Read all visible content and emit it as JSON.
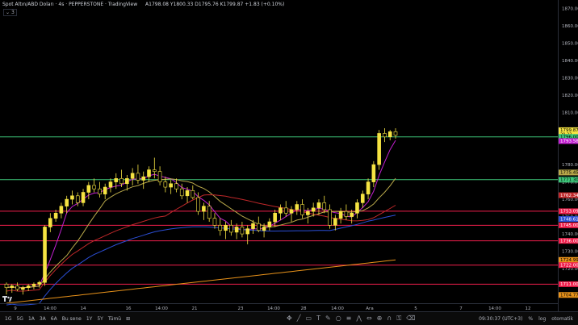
{
  "legend": {
    "symbol": "Spot Altın/ABD Doları · 4s · PEPPERSTONE · TradingView",
    "ohlc": "A1798.08 Y1800.33 D1795.76 K1799.87 +1.83 (+0.10%)",
    "collapse_label": "3"
  },
  "colors": {
    "background": "#000000",
    "up_candle": "#f5e342",
    "ma_purple": "#c31fd1",
    "ma_khaki": "#b8a84a",
    "ma_red": "#c0282a",
    "ma_blue": "#2b4ed6",
    "ma_orange": "#e8921a",
    "hline_red": "#f01e4b",
    "hline_green": "#3ec77a"
  },
  "price_axis": {
    "ticks": [
      "1870.00",
      "1860.00",
      "1850.00",
      "1840.00",
      "1830.00",
      "1820.00",
      "1810.00",
      "1780.00",
      "1770.00",
      "1760.00",
      "1750.00",
      "1740.00",
      "1730.00",
      "1720.00"
    ],
    "badges": [
      {
        "label": "1799.87",
        "sub": "29:22",
        "bg": "#f5e342",
        "fg": "#000"
      },
      {
        "label": "1796.00",
        "bg": "#3ec77a",
        "fg": "#000"
      },
      {
        "label": "1793.58",
        "bg": "#c31fd1",
        "fg": "#fff"
      },
      {
        "label": "1775.45",
        "bg": "#b8a84a",
        "fg": "#000"
      },
      {
        "label": "1771.30",
        "bg": "#3ec77a",
        "fg": "#000"
      },
      {
        "label": "1762.34",
        "bg": "#c0282a",
        "fg": "#fff"
      },
      {
        "label": "1753.09",
        "bg": "#f01e4b",
        "fg": "#fff"
      },
      {
        "label": "1748.61",
        "bg": "#2b4ed6",
        "fg": "#fff"
      },
      {
        "label": "1745.00",
        "bg": "#f01e4b",
        "fg": "#fff"
      },
      {
        "label": "1736.00",
        "bg": "#f01e4b",
        "fg": "#fff"
      },
      {
        "label": "1724.99",
        "bg": "#e8921a",
        "fg": "#000"
      },
      {
        "label": "1722.00",
        "bg": "#f01e4b",
        "fg": "#fff"
      },
      {
        "label": "1711.00",
        "bg": "#f01e4b",
        "fg": "#fff"
      },
      {
        "label": "1704.77",
        "bg": "#e8921a",
        "fg": "#000"
      }
    ]
  },
  "time_axis": [
    "9",
    "14:00",
    "14",
    "16",
    "14:00",
    "21",
    "23",
    "14:00",
    "28",
    "14:00",
    "Ara",
    "5",
    "7",
    "14:00",
    "12"
  ],
  "bottombar": {
    "ranges": [
      "1G",
      "5G",
      "1A",
      "3A",
      "6A",
      "Bu sene",
      "1Y",
      "5Y",
      "Tümü"
    ],
    "clock": "09:30:37 (UTC+3)",
    "percent": "%",
    "log": "log",
    "auto": "otomatik"
  },
  "chart_data": {
    "type": "candlestick",
    "ylim": [
      1700,
      1875
    ],
    "horizontal_levels": [
      {
        "value": 1796.0,
        "color": "green"
      },
      {
        "value": 1771.3,
        "color": "green"
      },
      {
        "value": 1753.09,
        "color": "red"
      },
      {
        "value": 1745.0,
        "color": "red"
      },
      {
        "value": 1736.0,
        "color": "red"
      },
      {
        "value": 1722.0,
        "color": "red"
      },
      {
        "value": 1711.0,
        "color": "red"
      }
    ],
    "candles": [
      [
        1711,
        1712,
        1705,
        1709
      ],
      [
        1709,
        1711,
        1706,
        1710
      ],
      [
        1710,
        1712,
        1707,
        1708
      ],
      [
        1708,
        1710,
        1705,
        1709
      ],
      [
        1709,
        1711,
        1707,
        1710
      ],
      [
        1710,
        1712,
        1708,
        1711
      ],
      [
        1711,
        1713,
        1709,
        1712
      ],
      [
        1712,
        1745,
        1710,
        1744
      ],
      [
        1744,
        1752,
        1741,
        1749
      ],
      [
        1749,
        1754,
        1747,
        1752
      ],
      [
        1752,
        1758,
        1749,
        1756
      ],
      [
        1756,
        1762,
        1752,
        1760
      ],
      [
        1760,
        1765,
        1757,
        1762
      ],
      [
        1762,
        1764,
        1756,
        1758
      ],
      [
        1758,
        1766,
        1756,
        1764
      ],
      [
        1764,
        1770,
        1760,
        1768
      ],
      [
        1768,
        1772,
        1764,
        1766
      ],
      [
        1766,
        1770,
        1761,
        1763
      ],
      [
        1763,
        1769,
        1760,
        1767
      ],
      [
        1767,
        1772,
        1764,
        1770
      ],
      [
        1770,
        1775,
        1766,
        1772
      ],
      [
        1772,
        1777,
        1767,
        1769
      ],
      [
        1769,
        1774,
        1765,
        1772
      ],
      [
        1772,
        1778,
        1768,
        1775
      ],
      [
        1775,
        1780,
        1769,
        1771
      ],
      [
        1771,
        1776,
        1766,
        1773
      ],
      [
        1773,
        1779,
        1770,
        1777
      ],
      [
        1777,
        1784,
        1772,
        1776
      ],
      [
        1776,
        1779,
        1768,
        1770
      ],
      [
        1770,
        1773,
        1764,
        1767
      ],
      [
        1767,
        1771,
        1763,
        1769
      ],
      [
        1769,
        1772,
        1764,
        1766
      ],
      [
        1766,
        1769,
        1760,
        1762
      ],
      [
        1762,
        1767,
        1758,
        1765
      ],
      [
        1765,
        1768,
        1760,
        1761
      ],
      [
        1761,
        1764,
        1751,
        1753
      ],
      [
        1753,
        1758,
        1748,
        1756
      ],
      [
        1756,
        1759,
        1747,
        1749
      ],
      [
        1749,
        1752,
        1743,
        1745
      ],
      [
        1745,
        1749,
        1739,
        1742
      ],
      [
        1742,
        1747,
        1737,
        1745
      ],
      [
        1745,
        1748,
        1739,
        1741
      ],
      [
        1741,
        1746,
        1737,
        1744
      ],
      [
        1744,
        1747,
        1738,
        1740
      ],
      [
        1740,
        1745,
        1734,
        1743
      ],
      [
        1743,
        1748,
        1740,
        1746
      ],
      [
        1746,
        1750,
        1741,
        1742
      ],
      [
        1742,
        1746,
        1738,
        1744
      ],
      [
        1744,
        1749,
        1742,
        1747
      ],
      [
        1747,
        1754,
        1744,
        1752
      ],
      [
        1752,
        1757,
        1748,
        1755
      ],
      [
        1755,
        1759,
        1750,
        1752
      ],
      [
        1752,
        1756,
        1747,
        1754
      ],
      [
        1754,
        1759,
        1751,
        1757
      ],
      [
        1757,
        1760,
        1749,
        1751
      ],
      [
        1751,
        1755,
        1746,
        1753
      ],
      [
        1753,
        1758,
        1750,
        1755
      ],
      [
        1755,
        1760,
        1751,
        1758
      ],
      [
        1758,
        1762,
        1752,
        1754
      ],
      [
        1754,
        1757,
        1743,
        1745
      ],
      [
        1745,
        1751,
        1742,
        1749
      ],
      [
        1749,
        1755,
        1746,
        1753
      ],
      [
        1753,
        1757,
        1748,
        1750
      ],
      [
        1750,
        1754,
        1746,
        1752
      ],
      [
        1752,
        1760,
        1749,
        1758
      ],
      [
        1758,
        1765,
        1755,
        1763
      ],
      [
        1763,
        1772,
        1760,
        1770
      ],
      [
        1770,
        1782,
        1767,
        1780
      ],
      [
        1780,
        1800,
        1777,
        1798
      ],
      [
        1798,
        1801,
        1793,
        1796
      ],
      [
        1796,
        1800,
        1794,
        1799
      ],
      [
        1799,
        1801,
        1795,
        1797
      ]
    ]
  }
}
